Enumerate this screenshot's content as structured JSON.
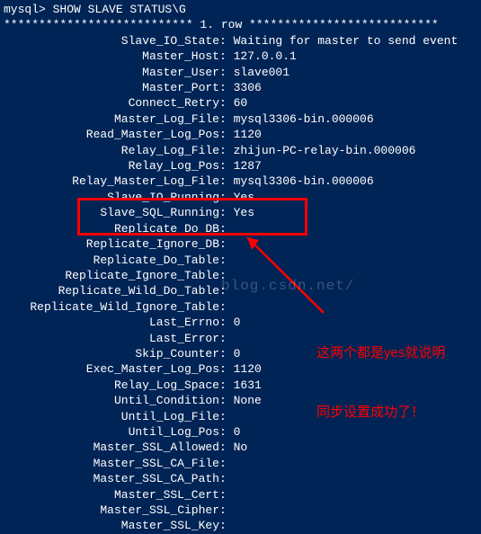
{
  "prompt": "mysql> SHOW SLAVE STATUS\\G",
  "row_header": "*************************** 1. row ***************************",
  "fields": [
    {
      "k": "Slave_IO_State",
      "v": "Waiting for master to send event"
    },
    {
      "k": "Master_Host",
      "v": "127.0.0.1"
    },
    {
      "k": "Master_User",
      "v": "slave001"
    },
    {
      "k": "Master_Port",
      "v": "3306"
    },
    {
      "k": "Connect_Retry",
      "v": "60"
    },
    {
      "k": "Master_Log_File",
      "v": "mysql3306-bin.000006"
    },
    {
      "k": "Read_Master_Log_Pos",
      "v": "1120"
    },
    {
      "k": "Relay_Log_File",
      "v": "zhijun-PC-relay-bin.000006"
    },
    {
      "k": "Relay_Log_Pos",
      "v": "1287"
    },
    {
      "k": "Relay_Master_Log_File",
      "v": "mysql3306-bin.000006"
    },
    {
      "k": "Slave_IO_Running",
      "v": "Yes"
    },
    {
      "k": "Slave_SQL_Running",
      "v": "Yes"
    },
    {
      "k": "Replicate_Do_DB",
      "v": ""
    },
    {
      "k": "Replicate_Ignore_DB",
      "v": ""
    },
    {
      "k": "Replicate_Do_Table",
      "v": ""
    },
    {
      "k": "Replicate_Ignore_Table",
      "v": ""
    },
    {
      "k": "Replicate_Wild_Do_Table",
      "v": ""
    },
    {
      "k": "Replicate_Wild_Ignore_Table",
      "v": ""
    },
    {
      "k": "Last_Errno",
      "v": "0"
    },
    {
      "k": "Last_Error",
      "v": ""
    },
    {
      "k": "Skip_Counter",
      "v": "0"
    },
    {
      "k": "Exec_Master_Log_Pos",
      "v": "1120"
    },
    {
      "k": "Relay_Log_Space",
      "v": "1631"
    },
    {
      "k": "Until_Condition",
      "v": "None"
    },
    {
      "k": "Until_Log_File",
      "v": ""
    },
    {
      "k": "Until_Log_Pos",
      "v": "0"
    },
    {
      "k": "Master_SSL_Allowed",
      "v": "No"
    },
    {
      "k": "Master_SSL_CA_File",
      "v": ""
    },
    {
      "k": "Master_SSL_CA_Path",
      "v": ""
    },
    {
      "k": "Master_SSL_Cert",
      "v": ""
    },
    {
      "k": "Master_SSL_Cipher",
      "v": ""
    },
    {
      "k": "Master_SSL_Key",
      "v": ""
    }
  ],
  "annotation_line1": "这两个都是yes就说明",
  "annotation_line2": "同步设置成功了！",
  "watermark": "blog.csdn.net/",
  "colors": {
    "bg": "#002456",
    "text": "#ffffff",
    "highlight": "#ff0000"
  }
}
